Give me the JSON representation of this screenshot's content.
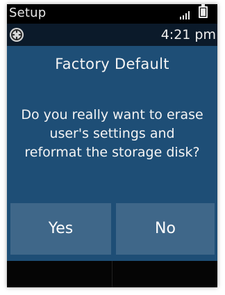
{
  "status_bar": {
    "title": "Setup",
    "signal_icon": "signal-strength-icon",
    "battery_icon": "battery-icon"
  },
  "info_bar": {
    "globe_icon": "globe-icon",
    "time": "4:21 pm"
  },
  "dialog": {
    "title": "Factory Default",
    "message_lines": [
      "Do you really want to erase",
      "user's settings and",
      "reformat the storage disk?"
    ],
    "yes_label": "Yes",
    "no_label": "No"
  },
  "colors": {
    "background": "#1e4e76",
    "button": "#3f6789",
    "status_bar": "#000000",
    "info_bar": "#0b1a2a",
    "text": "#f4f4f4"
  }
}
